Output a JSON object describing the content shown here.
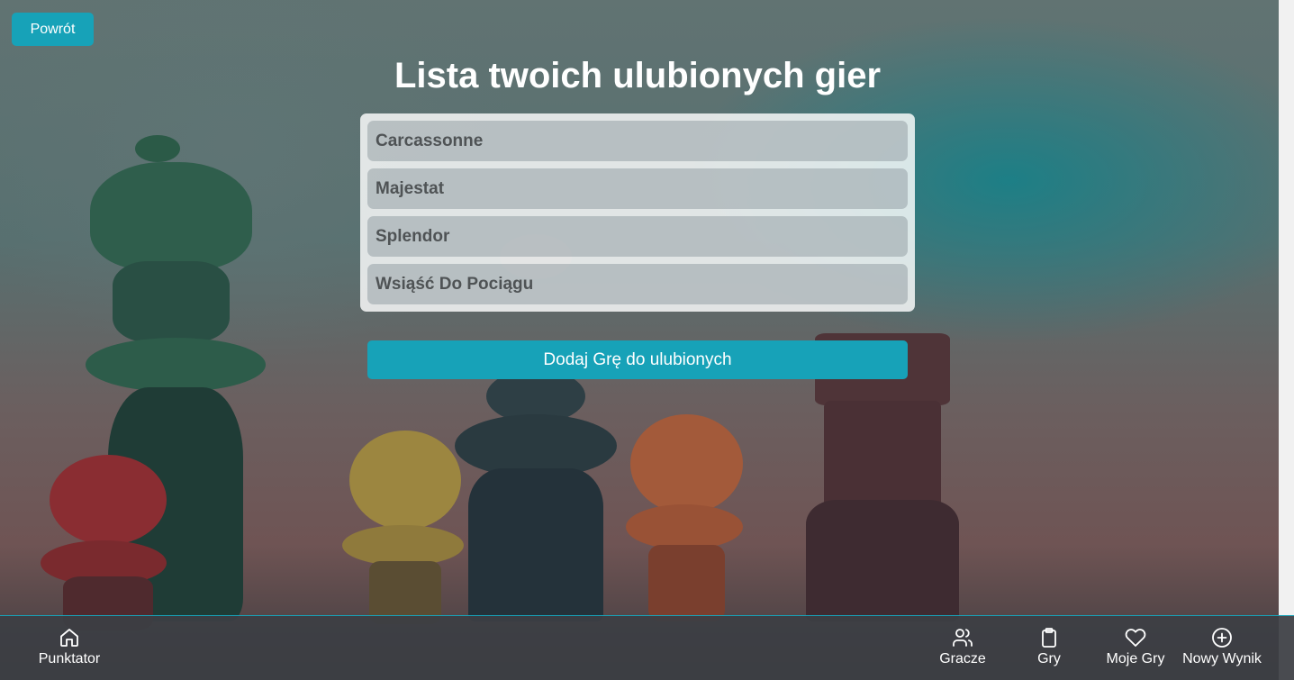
{
  "header": {
    "back_label": "Powrót",
    "title": "Lista twoich ulubionych gier"
  },
  "favorites": {
    "items": [
      "Carcassonne",
      "Majestat",
      "Splendor",
      "Wsiąść Do Pociągu"
    ],
    "add_label": "Dodaj Grę do ulubionych"
  },
  "nav": {
    "brand": {
      "label": "Punktator",
      "icon": "home-icon"
    },
    "items": [
      {
        "label": "Gracze",
        "icon": "users-icon"
      },
      {
        "label": "Gry",
        "icon": "clipboard-icon"
      },
      {
        "label": "Moje Gry",
        "icon": "heart-icon"
      },
      {
        "label": "Nowy Wynik",
        "icon": "plus-circle-icon"
      }
    ]
  },
  "colors": {
    "accent": "#17a2b8",
    "nav_background": "#3c3e44",
    "title_text": "#ffffff"
  }
}
